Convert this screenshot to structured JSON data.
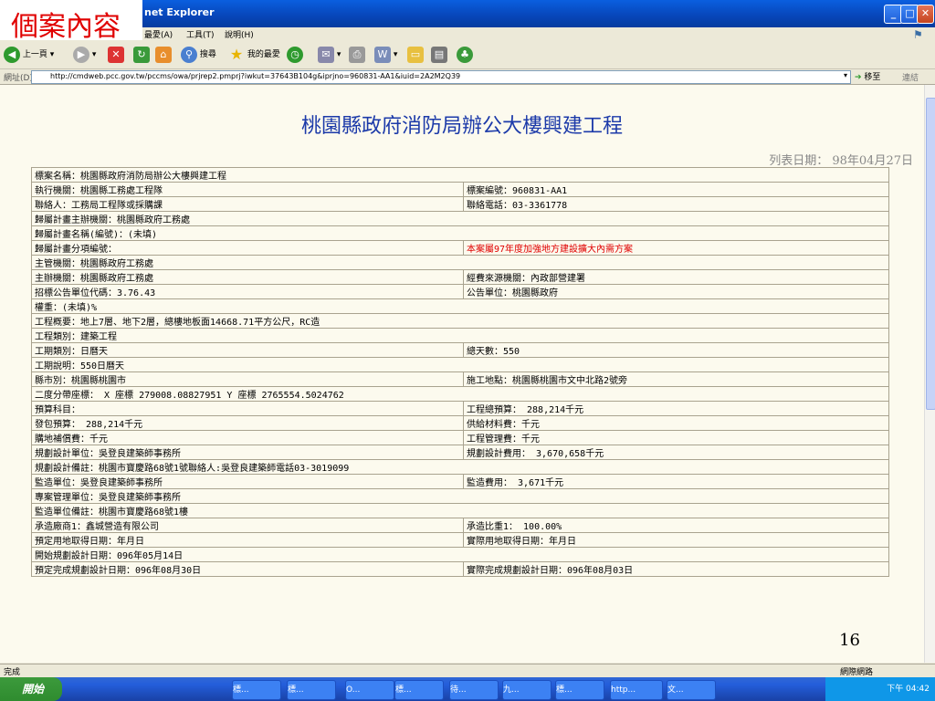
{
  "window": {
    "title": "net Explorer"
  },
  "overlay_label": "個案內容",
  "menu": [
    "最愛(A)",
    "工具(T)",
    "說明(H)"
  ],
  "toolbar": {
    "back": "上一頁",
    "search": "搜尋",
    "favorites": "我的最愛"
  },
  "address": {
    "label": "網址(D)",
    "url": "http://cmdweb.pcc.gov.tw/pccms/owa/prjrep2.pmprj?iwkut=37643B104g&iprjno=960831-AA1&iuid=2A2M2Q39",
    "go": "移至",
    "links": "連結"
  },
  "page": {
    "title": "桃園縣政府消防局辦公大樓興建工程",
    "list_date": "列表日期： 98年04月27日",
    "page_number": "16"
  },
  "rows": [
    {
      "a": "標案名稱：桃園縣政府消防局辦公大樓興建工程",
      "b": null
    },
    {
      "a": "執行機關：桃園縣工務處工程隊",
      "b": "標案編號：960831-AA1"
    },
    {
      "a": "聯絡人：工務局工程隊或採購課",
      "b": "聯絡電話：03-3361778"
    },
    {
      "a": "歸屬計畫主辦機關：桃園縣政府工務處",
      "b": null
    },
    {
      "a": "歸屬計畫名稱(編號)：(未填)",
      "b": null
    },
    {
      "a": "歸屬計畫分項編號：",
      "b": "本案屬97年度加強地方建設擴大內需方案",
      "b_red": true
    },
    {
      "a": "主管機關：桃園縣政府工務處",
      "b": null
    },
    {
      "a": "主辦機關：桃園縣政府工務處",
      "b": "經費來源機關：內政部營建署"
    },
    {
      "a": "招標公告單位代碼：3.76.43",
      "b": "公告單位：桃園縣政府"
    },
    {
      "a": "權重：(未填)%",
      "b": null
    },
    {
      "a": "工程概要：地上7層、地下2層，總樓地板面14668.71平方公尺，RC造",
      "b": null
    },
    {
      "a": "工程類別：建築工程",
      "b": null
    },
    {
      "a": "工期類別：日曆天",
      "b": "總天數：550"
    },
    {
      "a": "工期說明：550日曆天",
      "b": null
    },
    {
      "a": "縣市別：桃園縣桃園市",
      "b": "施工地點：桃園縣桃園市文中北路2號旁"
    },
    {
      "a": "二度分帶座標：   X 座標  279008.08827951  Y 座標  2765554.5024762",
      "b": null
    },
    {
      "a": "預算科目：",
      "b": "工程總預算： 288,214千元"
    },
    {
      "a": "發包預算： 288,214千元",
      "b": "供給材料費：千元"
    },
    {
      "a": "購地補償費：千元",
      "b": "工程管理費：千元"
    },
    {
      "a": "規劃設計單位：吳登良建築師事務所",
      "b": "規劃設計費用： 3,670,658千元"
    },
    {
      "a": "規劃設計備註：桃園市寶慶路68號1號聯絡人:吳登良建築師電話03-3019099",
      "b": null
    },
    {
      "a": "監造單位：吳登良建築師事務所",
      "b": "監造費用： 3,671千元"
    },
    {
      "a": "專案管理單位：吳登良建築師事務所",
      "b": null
    },
    {
      "a": "監造單位備註：桃園市寶慶路68號1樓",
      "b": null
    },
    {
      "a": "承造廠商1：鑫城營造有限公司",
      "b": "承造比重1： 100.00%"
    },
    {
      "a": "預定用地取得日期：年月日",
      "b": "實際用地取得日期：年月日"
    },
    {
      "a": "開始規劃設計日期：096年05月14日",
      "b": null
    },
    {
      "a": "預定完成規劃設計日期：096年08月30日",
      "b": "實際完成規劃設計日期：096年08月03日"
    }
  ],
  "status": {
    "left": "完成",
    "right": "網際網路"
  },
  "taskbar": {
    "start": "開始",
    "tasks": [
      "標...",
      "標...",
      "O...",
      "標...",
      "待...",
      "九...",
      "標...",
      "http...",
      "文..."
    ],
    "clock": "下午 04:42"
  }
}
